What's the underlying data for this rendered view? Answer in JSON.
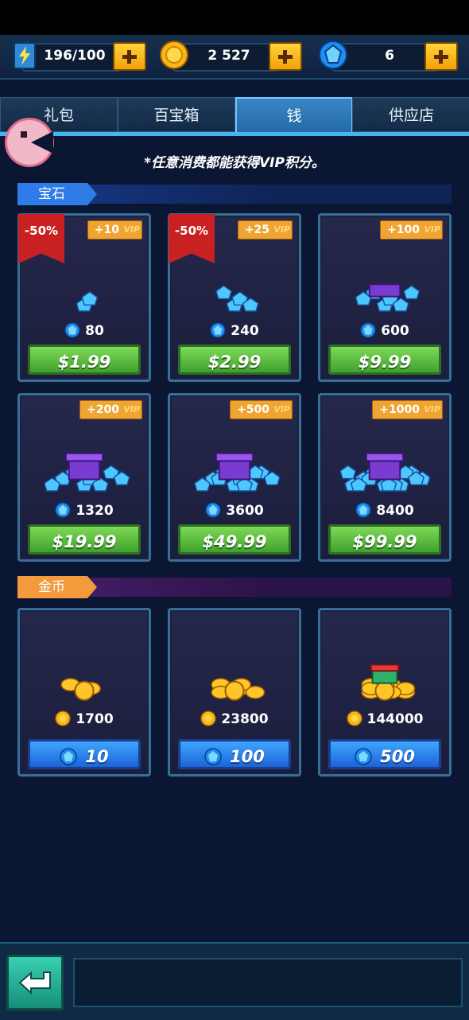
{
  "resources": {
    "energy": {
      "value": "196/100",
      "icon": "lightning-battery-icon"
    },
    "coins": {
      "value": "2 527",
      "icon": "gold-coin-icon"
    },
    "gems": {
      "value": "6",
      "icon": "blue-gem-icon"
    }
  },
  "tabs": [
    {
      "label": "礼包",
      "active": false
    },
    {
      "label": "百宝箱",
      "active": false
    },
    {
      "label": "钱",
      "active": true
    },
    {
      "label": "供应店",
      "active": false
    }
  ],
  "vip_note": "*任意消费都能获得VIP积分。",
  "sections": {
    "gems_title": "宝石",
    "coins_title": "金币"
  },
  "gem_packs": [
    {
      "amount": "80",
      "price": "$1.99",
      "vip": "+10",
      "discount": "-50%"
    },
    {
      "amount": "240",
      "price": "$2.99",
      "vip": "+25",
      "discount": "-50%"
    },
    {
      "amount": "600",
      "price": "$9.99",
      "vip": "+100",
      "discount": ""
    },
    {
      "amount": "1320",
      "price": "$19.99",
      "vip": "+200",
      "discount": ""
    },
    {
      "amount": "3600",
      "price": "$49.99",
      "vip": "+500",
      "discount": ""
    },
    {
      "amount": "8400",
      "price": "$99.99",
      "vip": "+1000",
      "discount": ""
    }
  ],
  "coin_packs": [
    {
      "amount": "1700",
      "cost": "10"
    },
    {
      "amount": "23800",
      "cost": "100"
    },
    {
      "amount": "144000",
      "cost": "500"
    }
  ],
  "vip_tag": "VIP",
  "colors": {
    "accent": "#43b6f0",
    "price_green": "#4fb336",
    "price_blue": "#2a84f0",
    "vip_orange": "#f0a432"
  }
}
